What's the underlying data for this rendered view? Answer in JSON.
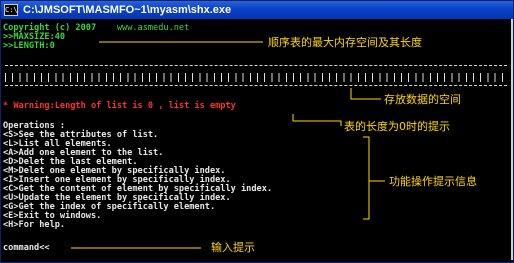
{
  "window": {
    "title": "C:\\JMSOFT\\MASMFO~1\\myasm\\shx.exe",
    "icon": "console-icon"
  },
  "console": {
    "copyright": "Copyright (c) 2007",
    "site": "www.asmedu.net",
    "maxsize": ">>MAXSIZE:40",
    "length": ">>LENGTH:0",
    "warning": "* Warning:Length of list is 0 , list is empty",
    "operations_header": "Operations :",
    "operations": [
      "<S>See the attributes of list.",
      "<L>List all elements.",
      "<A>Add one element to the list.",
      "<D>Delet the last element.",
      "<M>Delet one element by specifically index.",
      "<I>Insert one element by specifically index.",
      "<C>Get the content of element by specifically index.",
      "<U>Update the element by specifically index.",
      "<G>Get the index of specifically element.",
      "<E>Exit to windows.",
      "<H>For help."
    ],
    "prompt": "command<<"
  },
  "annotations": {
    "max_length": "顺序表的最大内存空间及其长度",
    "storage": "存放数据的空间",
    "zero_hint": "表的长度为0时的提示",
    "ops_hint": "功能操作提示信息",
    "input_hint": "输入提示"
  },
  "colors": {
    "title_bar": "#0a42c8",
    "console_bg": "#000000",
    "green_text": "#3cd43c",
    "white_text": "#e8e8e8",
    "warning_red": "#ff3030",
    "annotation_yellow": "#ffd700"
  }
}
